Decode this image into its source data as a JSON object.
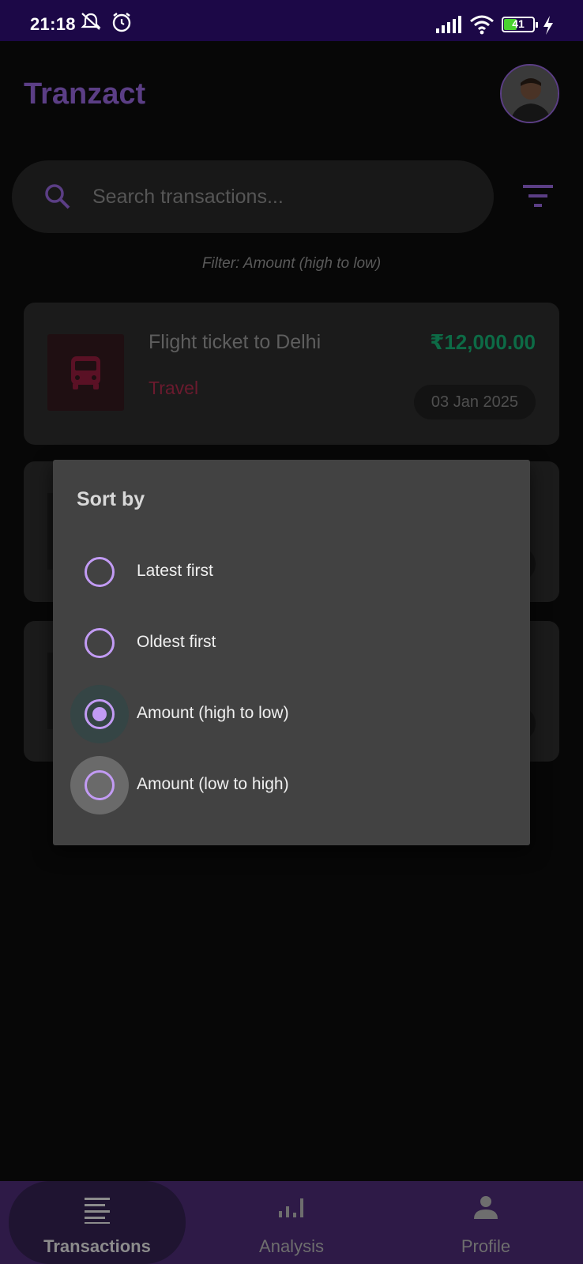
{
  "status_bar": {
    "time": "21:18",
    "battery": "41",
    "icons": [
      "mute-icon",
      "alarm-icon",
      "signal-icon",
      "wifi-icon",
      "battery-icon",
      "charging-icon"
    ]
  },
  "header": {
    "title": "Tranzact",
    "avatar": "avatar"
  },
  "search": {
    "placeholder": "Search transactions...",
    "value": ""
  },
  "filter_caption": "Filter: Amount (high to low)",
  "transactions": [
    {
      "title": "Flight ticket to Delhi",
      "category": "Travel",
      "amount": "₹12,000.00",
      "date": "03 Jan 2025",
      "icon": "bus-icon"
    }
  ],
  "sort_dialog": {
    "title": "Sort by",
    "options": [
      {
        "label": "Latest first",
        "selected": false
      },
      {
        "label": "Oldest first",
        "selected": false
      },
      {
        "label": "Amount (high to low)",
        "selected": true
      },
      {
        "label": "Amount (low to high)",
        "selected": false
      }
    ]
  },
  "bottom_nav": {
    "items": [
      {
        "label": "Transactions",
        "icon": "list-icon",
        "active": true
      },
      {
        "label": "Analysis",
        "icon": "bar-chart-icon",
        "active": false
      },
      {
        "label": "Profile",
        "icon": "person-icon",
        "active": false
      }
    ]
  },
  "colors": {
    "status_bar": "#1c0847",
    "accent": "#c29bf4",
    "title": "#5b3e85",
    "amount": "#0d6b46",
    "category": "#6b1a2e",
    "dialog": "#424242",
    "nav": "#2e1a47"
  }
}
